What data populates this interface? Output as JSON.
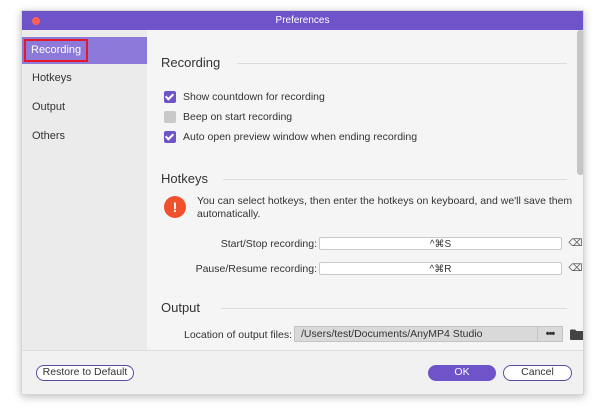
{
  "window": {
    "title": "Preferences"
  },
  "sidebar": {
    "items": [
      {
        "label": "Recording",
        "active": true
      },
      {
        "label": "Hotkeys",
        "active": false
      },
      {
        "label": "Output",
        "active": false
      },
      {
        "label": "Others",
        "active": false
      }
    ]
  },
  "recording": {
    "title": "Recording",
    "options": [
      {
        "label": "Show countdown for recording",
        "checked": true
      },
      {
        "label": "Beep on start recording",
        "checked": false
      },
      {
        "label": "Auto open preview window when ending recording",
        "checked": true
      }
    ]
  },
  "hotkeys": {
    "title": "Hotkeys",
    "notice": "You can select hotkeys, then enter the hotkeys on keyboard, and we'll save them automatically.",
    "start_stop": {
      "label": "Start/Stop recording:",
      "value": "^⌘S"
    },
    "pause_resume": {
      "label": "Pause/Resume recording:",
      "value": "^⌘R"
    },
    "clear_glyph": "⌫"
  },
  "output": {
    "title": "Output",
    "location_label": "Location of output files:",
    "location_value": "/Users/test/Documents/AnyMP4 Studio",
    "more_label": "•••"
  },
  "footer": {
    "restore_label": "Restore to Default",
    "ok_label": "OK",
    "cancel_label": "Cancel"
  },
  "colors": {
    "accent": "#6e53c9",
    "sidebar_active": "#8d79d9",
    "highlight_box": "#e3182b",
    "warning": "#f0512c"
  }
}
